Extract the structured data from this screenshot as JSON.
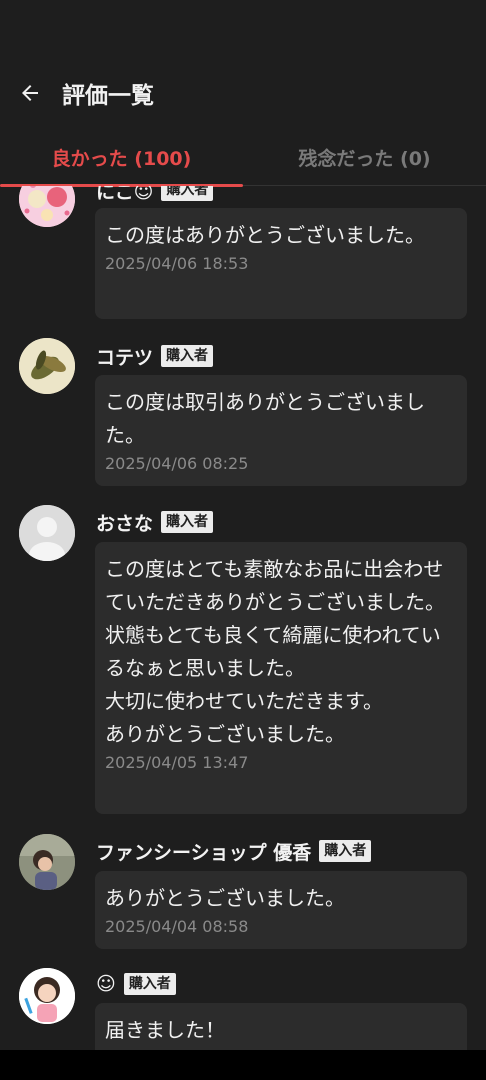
{
  "header": {
    "title": "評価一覧"
  },
  "tabs": [
    {
      "label": "良かった (100)",
      "active": true
    },
    {
      "label": "残念だった (0)",
      "active": false
    }
  ],
  "badge_label": "購入者",
  "reviews": [
    {
      "name": "にこ☺",
      "message": "この度はありがとうございました。",
      "timestamp": "2025/04/06 18:53"
    },
    {
      "name": "コテツ",
      "message": "この度は取引ありがとうございました。",
      "timestamp": "2025/04/06 08:25"
    },
    {
      "name": "おさな",
      "message": "この度はとても素敵なお品に出会わせていただきありがとうございました。\n状態もとても良くて綺麗に使われているなぁと思いました。\n大切に使わせていただきます。\nありがとうございました。",
      "timestamp": "2025/04/05 13:47"
    },
    {
      "name": "ファンシーショップ 優香",
      "message": "ありがとうございました。",
      "timestamp": "2025/04/04 08:58"
    },
    {
      "name": "☺",
      "message": "届きました！",
      "timestamp": ""
    }
  ],
  "colors": {
    "accent": "#e54b4b",
    "background": "#1e1e1e",
    "bubble": "#2c2c2c"
  }
}
